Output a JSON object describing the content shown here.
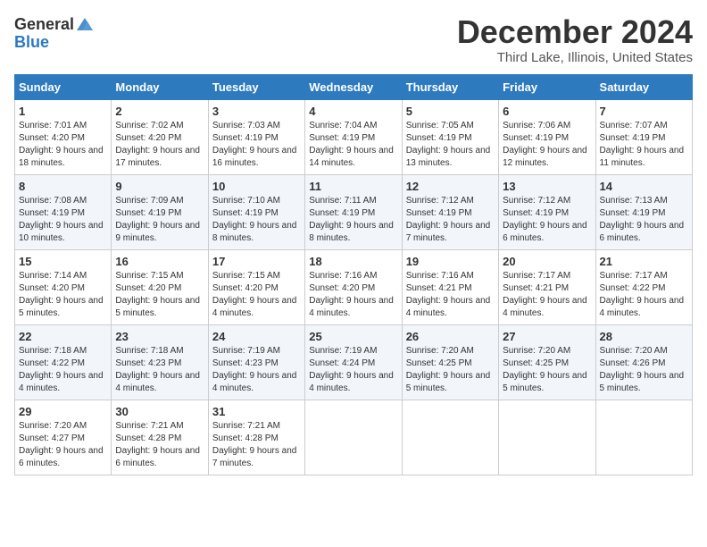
{
  "logo": {
    "general": "General",
    "blue": "Blue"
  },
  "header": {
    "month": "December 2024",
    "location": "Third Lake, Illinois, United States"
  },
  "weekdays": [
    "Sunday",
    "Monday",
    "Tuesday",
    "Wednesday",
    "Thursday",
    "Friday",
    "Saturday"
  ],
  "weeks": [
    [
      {
        "day": "1",
        "sunrise": "7:01 AM",
        "sunset": "4:20 PM",
        "daylight": "9 hours and 18 minutes."
      },
      {
        "day": "2",
        "sunrise": "7:02 AM",
        "sunset": "4:20 PM",
        "daylight": "9 hours and 17 minutes."
      },
      {
        "day": "3",
        "sunrise": "7:03 AM",
        "sunset": "4:19 PM",
        "daylight": "9 hours and 16 minutes."
      },
      {
        "day": "4",
        "sunrise": "7:04 AM",
        "sunset": "4:19 PM",
        "daylight": "9 hours and 14 minutes."
      },
      {
        "day": "5",
        "sunrise": "7:05 AM",
        "sunset": "4:19 PM",
        "daylight": "9 hours and 13 minutes."
      },
      {
        "day": "6",
        "sunrise": "7:06 AM",
        "sunset": "4:19 PM",
        "daylight": "9 hours and 12 minutes."
      },
      {
        "day": "7",
        "sunrise": "7:07 AM",
        "sunset": "4:19 PM",
        "daylight": "9 hours and 11 minutes."
      }
    ],
    [
      {
        "day": "8",
        "sunrise": "7:08 AM",
        "sunset": "4:19 PM",
        "daylight": "9 hours and 10 minutes."
      },
      {
        "day": "9",
        "sunrise": "7:09 AM",
        "sunset": "4:19 PM",
        "daylight": "9 hours and 9 minutes."
      },
      {
        "day": "10",
        "sunrise": "7:10 AM",
        "sunset": "4:19 PM",
        "daylight": "9 hours and 8 minutes."
      },
      {
        "day": "11",
        "sunrise": "7:11 AM",
        "sunset": "4:19 PM",
        "daylight": "9 hours and 8 minutes."
      },
      {
        "day": "12",
        "sunrise": "7:12 AM",
        "sunset": "4:19 PM",
        "daylight": "9 hours and 7 minutes."
      },
      {
        "day": "13",
        "sunrise": "7:12 AM",
        "sunset": "4:19 PM",
        "daylight": "9 hours and 6 minutes."
      },
      {
        "day": "14",
        "sunrise": "7:13 AM",
        "sunset": "4:19 PM",
        "daylight": "9 hours and 6 minutes."
      }
    ],
    [
      {
        "day": "15",
        "sunrise": "7:14 AM",
        "sunset": "4:20 PM",
        "daylight": "9 hours and 5 minutes."
      },
      {
        "day": "16",
        "sunrise": "7:15 AM",
        "sunset": "4:20 PM",
        "daylight": "9 hours and 5 minutes."
      },
      {
        "day": "17",
        "sunrise": "7:15 AM",
        "sunset": "4:20 PM",
        "daylight": "9 hours and 4 minutes."
      },
      {
        "day": "18",
        "sunrise": "7:16 AM",
        "sunset": "4:20 PM",
        "daylight": "9 hours and 4 minutes."
      },
      {
        "day": "19",
        "sunrise": "7:16 AM",
        "sunset": "4:21 PM",
        "daylight": "9 hours and 4 minutes."
      },
      {
        "day": "20",
        "sunrise": "7:17 AM",
        "sunset": "4:21 PM",
        "daylight": "9 hours and 4 minutes."
      },
      {
        "day": "21",
        "sunrise": "7:17 AM",
        "sunset": "4:22 PM",
        "daylight": "9 hours and 4 minutes."
      }
    ],
    [
      {
        "day": "22",
        "sunrise": "7:18 AM",
        "sunset": "4:22 PM",
        "daylight": "9 hours and 4 minutes."
      },
      {
        "day": "23",
        "sunrise": "7:18 AM",
        "sunset": "4:23 PM",
        "daylight": "9 hours and 4 minutes."
      },
      {
        "day": "24",
        "sunrise": "7:19 AM",
        "sunset": "4:23 PM",
        "daylight": "9 hours and 4 minutes."
      },
      {
        "day": "25",
        "sunrise": "7:19 AM",
        "sunset": "4:24 PM",
        "daylight": "9 hours and 4 minutes."
      },
      {
        "day": "26",
        "sunrise": "7:20 AM",
        "sunset": "4:25 PM",
        "daylight": "9 hours and 5 minutes."
      },
      {
        "day": "27",
        "sunrise": "7:20 AM",
        "sunset": "4:25 PM",
        "daylight": "9 hours and 5 minutes."
      },
      {
        "day": "28",
        "sunrise": "7:20 AM",
        "sunset": "4:26 PM",
        "daylight": "9 hours and 5 minutes."
      }
    ],
    [
      {
        "day": "29",
        "sunrise": "7:20 AM",
        "sunset": "4:27 PM",
        "daylight": "9 hours and 6 minutes."
      },
      {
        "day": "30",
        "sunrise": "7:21 AM",
        "sunset": "4:28 PM",
        "daylight": "9 hours and 6 minutes."
      },
      {
        "day": "31",
        "sunrise": "7:21 AM",
        "sunset": "4:28 PM",
        "daylight": "9 hours and 7 minutes."
      },
      null,
      null,
      null,
      null
    ]
  ]
}
